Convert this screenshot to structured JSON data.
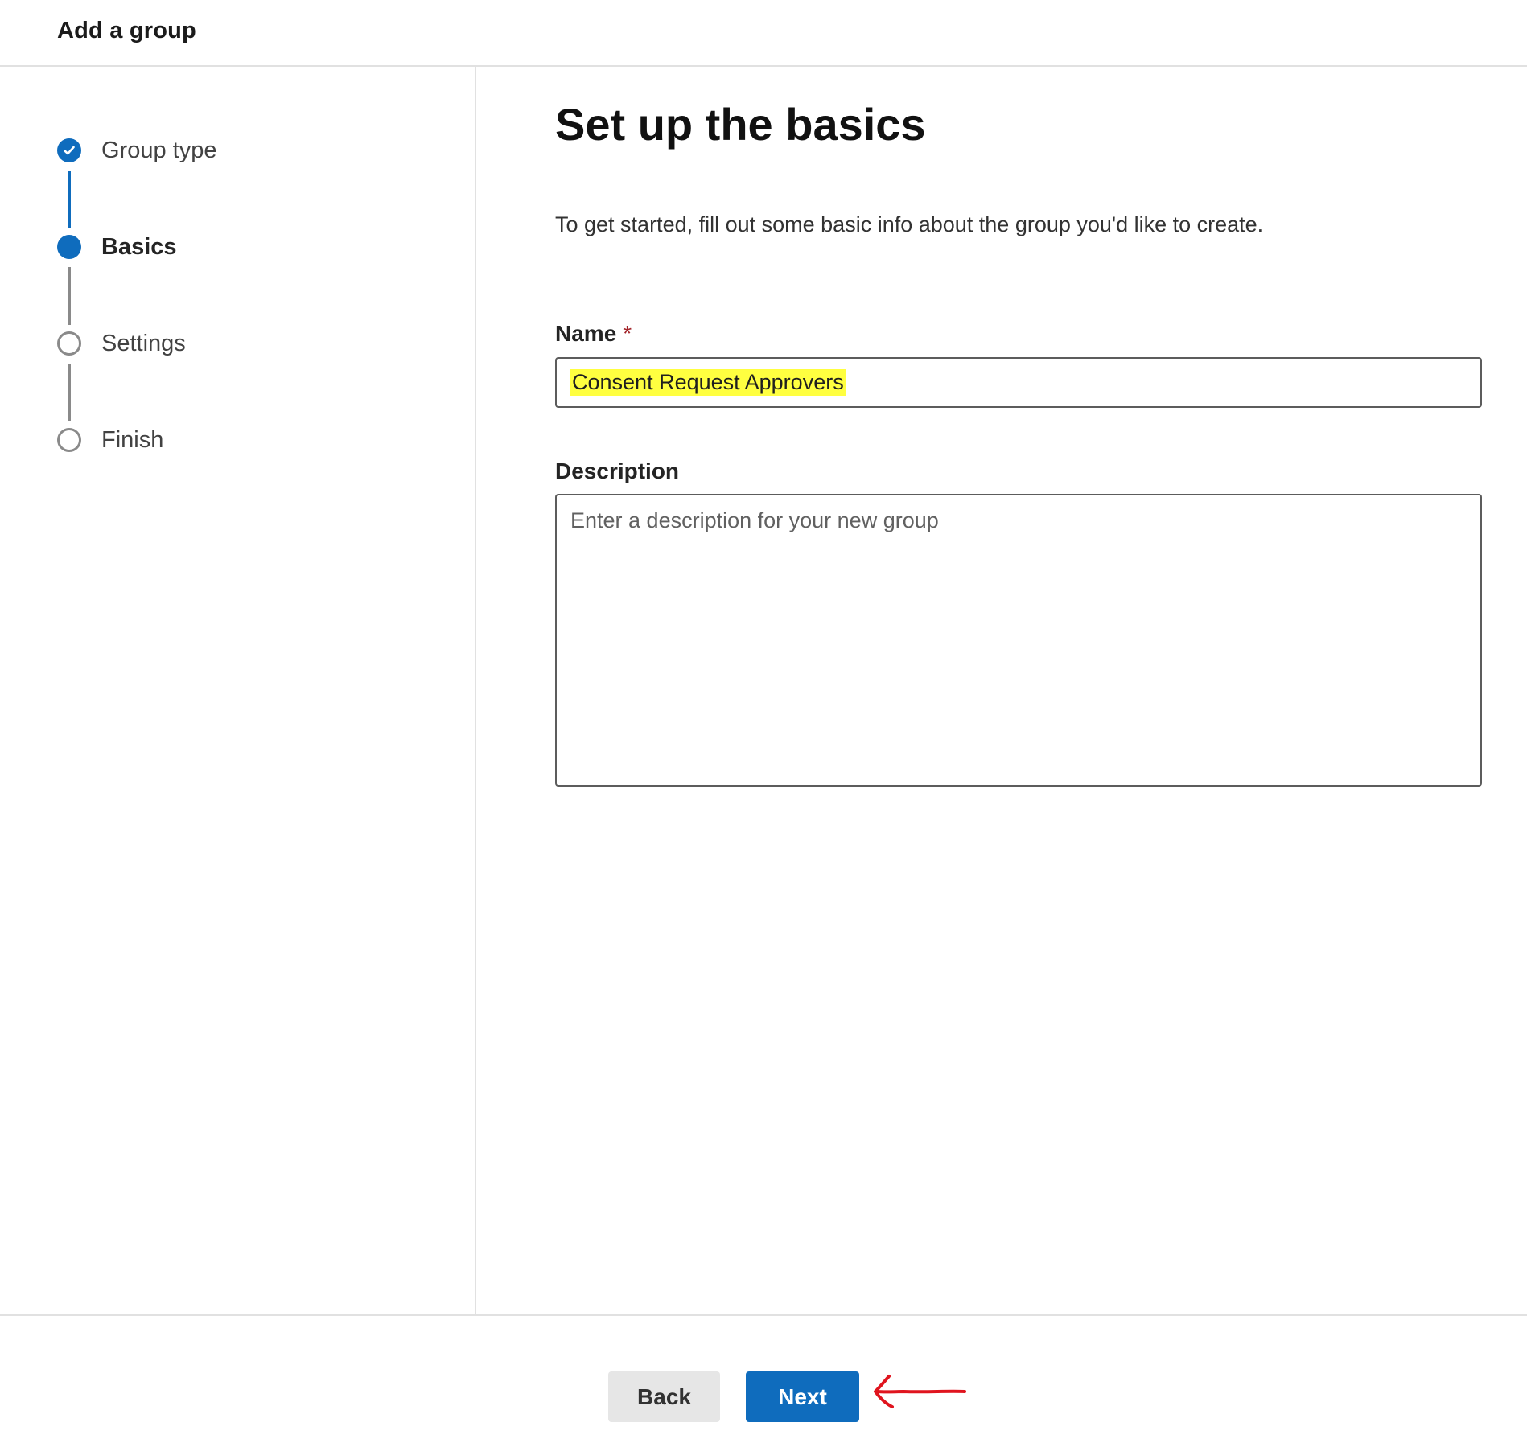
{
  "panel": {
    "title": "Add a group"
  },
  "steps": [
    {
      "label": "Group type",
      "state": "done"
    },
    {
      "label": "Basics",
      "state": "current"
    },
    {
      "label": "Settings",
      "state": "todo"
    },
    {
      "label": "Finish",
      "state": "todo"
    }
  ],
  "main": {
    "heading": "Set up the basics",
    "intro": "To get started, fill out some basic info about the group you'd like to create.",
    "name_field": {
      "label": "Name",
      "required_mark": "*",
      "value": "Consent Request Approvers"
    },
    "description_field": {
      "label": "Description",
      "placeholder": "Enter a description for your new group",
      "value": ""
    }
  },
  "footer": {
    "back_label": "Back",
    "next_label": "Next"
  },
  "colors": {
    "accent": "#0f6cbd",
    "highlight": "#ffff40",
    "annotation_arrow": "#e0141e",
    "required": "#a4262c"
  },
  "icons": {
    "step_done": "checkmark-circle-icon",
    "annotation": "arrow-left-icon"
  }
}
